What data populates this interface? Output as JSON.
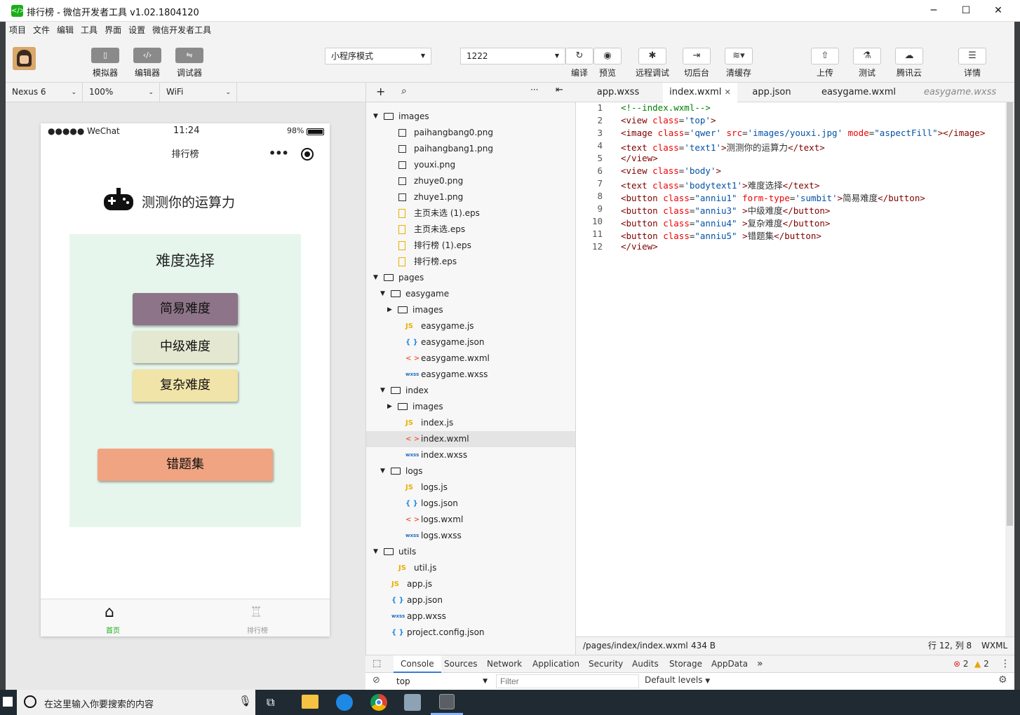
{
  "window": {
    "title": "排行榜 - 微信开发者工具 v1.02.1804120",
    "icon": "code-icon"
  },
  "menu": [
    "项目",
    "文件",
    "编辑",
    "工具",
    "界面",
    "设置",
    "微信开发者工具"
  ],
  "toolbar": {
    "left_buttons": [
      {
        "label": "模拟器",
        "icon": "phone-icon"
      },
      {
        "label": "编辑器",
        "icon": "code-icon"
      },
      {
        "label": "调试器",
        "icon": "sliders-icon"
      }
    ],
    "mode_select": "小程序模式",
    "compile_select": "1222",
    "right_buttons": [
      {
        "label": "编译",
        "icon": "refresh-icon"
      },
      {
        "label": "预览",
        "icon": "eye-icon"
      },
      {
        "label": "远程调试",
        "icon": "bug-icon"
      },
      {
        "label": "切后台",
        "icon": "switch-icon"
      },
      {
        "label": "清缓存",
        "icon": "layers-icon"
      },
      {
        "label": "上传",
        "icon": "upload-icon"
      },
      {
        "label": "测试",
        "icon": "flask-icon"
      },
      {
        "label": "腾讯云",
        "icon": "cloud-icon"
      },
      {
        "label": "详情",
        "icon": "menu-icon"
      }
    ]
  },
  "device_bar": {
    "device": "Nexus 6",
    "zoom": "100%",
    "network": "WiFi"
  },
  "phone": {
    "status": {
      "carrier": "●●●●● WeChat",
      "time": "11:24",
      "battery": "98%"
    },
    "nav_title": "排行榜",
    "header_text": "测测你的运算力",
    "section_title": "难度选择",
    "buttons": [
      "简易难度",
      "中级难度",
      "复杂难度"
    ],
    "wrong_button": "错题集",
    "tabbar": [
      {
        "label": "首页",
        "icon": "home-icon",
        "active": true
      },
      {
        "label": "排行榜",
        "icon": "trophy-icon",
        "active": false
      }
    ]
  },
  "tree": [
    {
      "depth": 0,
      "type": "folder",
      "open": true,
      "label": "images"
    },
    {
      "depth": 1,
      "type": "img",
      "label": "paihangbang0.png"
    },
    {
      "depth": 1,
      "type": "img",
      "label": "paihangbang1.png"
    },
    {
      "depth": 1,
      "type": "img",
      "label": "youxi.png"
    },
    {
      "depth": 1,
      "type": "img",
      "label": "zhuye0.png"
    },
    {
      "depth": 1,
      "type": "img",
      "label": "zhuye1.png"
    },
    {
      "depth": 1,
      "type": "eps",
      "label": "主页未选 (1).eps"
    },
    {
      "depth": 1,
      "type": "eps",
      "label": "主页未选.eps"
    },
    {
      "depth": 1,
      "type": "eps",
      "label": "排行榜 (1).eps"
    },
    {
      "depth": 1,
      "type": "eps",
      "label": "排行榜.eps"
    },
    {
      "depth": 0,
      "type": "folder",
      "open": true,
      "label": "pages"
    },
    {
      "depth": 1,
      "type": "folder",
      "open": true,
      "label": "easygame"
    },
    {
      "depth": 2,
      "type": "folder",
      "open": false,
      "label": "images"
    },
    {
      "depth": 2,
      "type": "js",
      "label": "easygame.js"
    },
    {
      "depth": 2,
      "type": "json",
      "label": "easygame.json"
    },
    {
      "depth": 2,
      "type": "wxml",
      "label": "easygame.wxml"
    },
    {
      "depth": 2,
      "type": "wxss",
      "label": "easygame.wxss"
    },
    {
      "depth": 1,
      "type": "folder",
      "open": true,
      "label": "index"
    },
    {
      "depth": 2,
      "type": "folder",
      "open": false,
      "label": "images"
    },
    {
      "depth": 2,
      "type": "js",
      "label": "index.js"
    },
    {
      "depth": 2,
      "type": "wxml",
      "label": "index.wxml",
      "selected": true
    },
    {
      "depth": 2,
      "type": "wxss",
      "label": "index.wxss"
    },
    {
      "depth": 1,
      "type": "folder",
      "open": true,
      "label": "logs"
    },
    {
      "depth": 2,
      "type": "js",
      "label": "logs.js"
    },
    {
      "depth": 2,
      "type": "json",
      "label": "logs.json"
    },
    {
      "depth": 2,
      "type": "wxml",
      "label": "logs.wxml"
    },
    {
      "depth": 2,
      "type": "wxss",
      "label": "logs.wxss"
    },
    {
      "depth": 0,
      "type": "folder",
      "open": true,
      "label": "utils"
    },
    {
      "depth": 1,
      "type": "js",
      "label": "util.js"
    },
    {
      "depth": 0,
      "type": "js",
      "label": "app.js"
    },
    {
      "depth": 0,
      "type": "json",
      "label": "app.json"
    },
    {
      "depth": 0,
      "type": "wxss",
      "label": "app.wxss"
    },
    {
      "depth": 0,
      "type": "json",
      "label": "project.config.json"
    }
  ],
  "file_icons": {
    "js": "JS",
    "json": "{ }",
    "wxml": "< >",
    "wxss": "wxss"
  },
  "tabs": [
    {
      "label": "app.wxss"
    },
    {
      "label": "index.wxml",
      "active": true
    },
    {
      "label": "app.json"
    },
    {
      "label": "easygame.wxml"
    },
    {
      "label": "easygame.wxss",
      "italic": true
    }
  ],
  "code": [
    "<!--index.wxml-->",
    "<view class='top'>",
    "<image class='qwer' src='images/youxi.jpg' mode=\"aspectFill\"></image>",
    "<text class='text1'>测测你的运算力</text>",
    "</view>",
    "<view class='body'>",
    "<text class='bodytext1'>难度选择</text>",
    "<button class=\"anniu1\" form-type='sumbit'>简易难度</button>",
    "<button class=\"anniu3\" >中级难度</button>",
    "<button class=\"anniu4\" >复杂难度</button>",
    "<button class=\"anniu5\" >错题集</button>",
    "</view>"
  ],
  "status": {
    "path": "/pages/index/index.wxml",
    "size": "434 B",
    "cursor": "行 12, 列 8",
    "lang": "WXML"
  },
  "devtools": {
    "tabs": [
      "Console",
      "Sources",
      "Network",
      "Application",
      "Security",
      "Audits",
      "Storage",
      "AppData"
    ],
    "more": "»",
    "errors": "2",
    "warnings": "2",
    "context": "top",
    "filter_placeholder": "Filter",
    "levels": "Default levels"
  },
  "taskbar": {
    "search_placeholder": "在这里输入你要搜索的内容"
  },
  "colors": {
    "easy": "#8d7488",
    "mid": "#e5e8d1",
    "hard": "#f1e4a8",
    "wrong": "#f0a481",
    "panel": "#e6f6ec",
    "tabbar_active": "#1aad19"
  }
}
